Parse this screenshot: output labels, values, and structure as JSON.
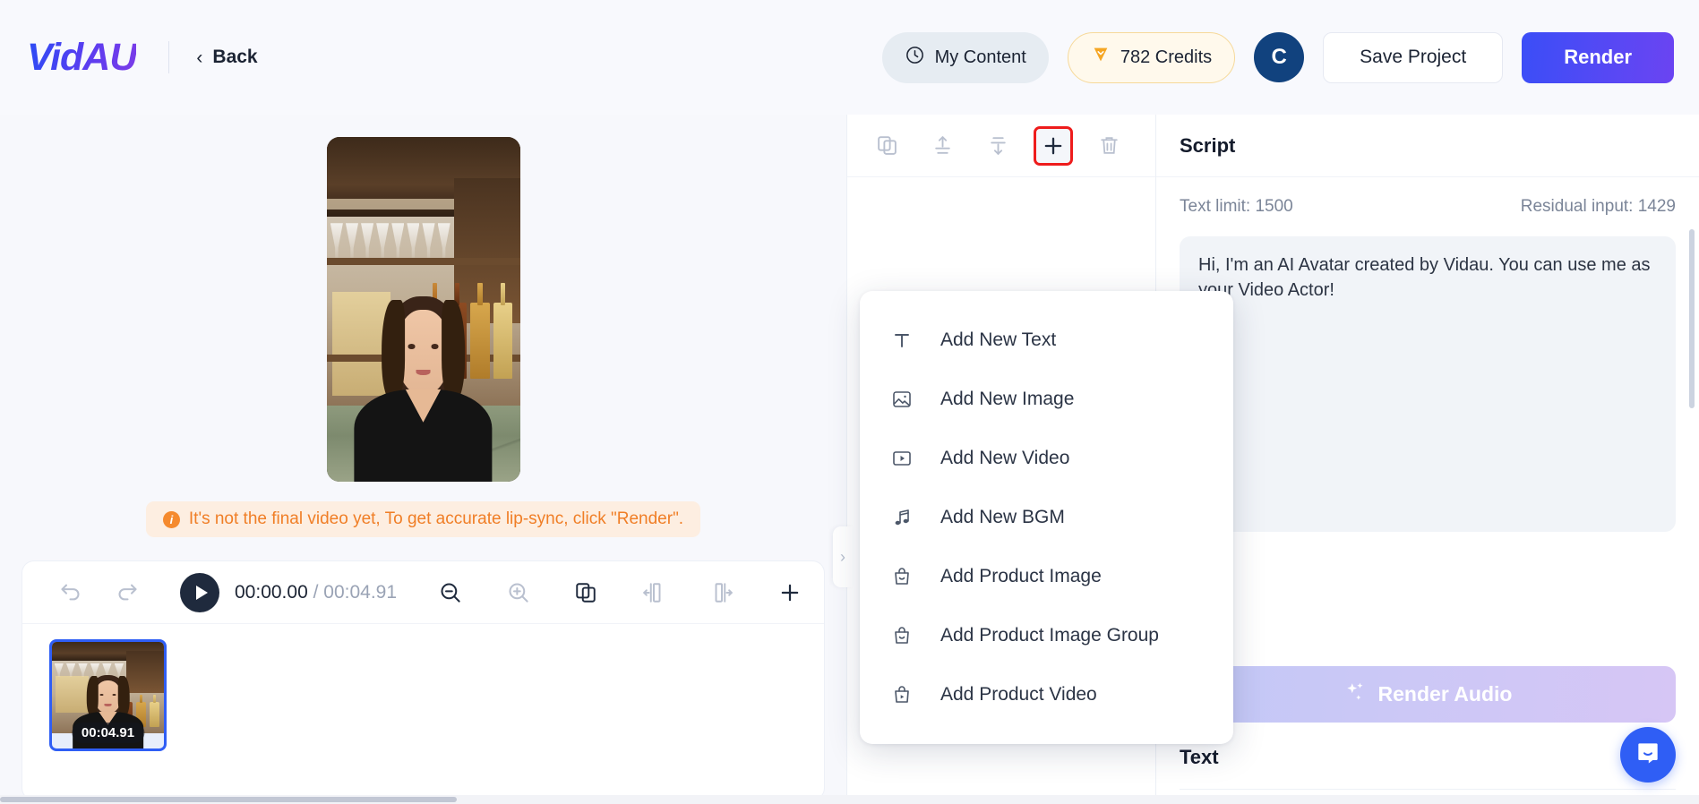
{
  "header": {
    "logo": "VidAU",
    "back_label": "Back",
    "back_icon": "chevron-left-icon",
    "my_content_label": "My Content",
    "my_content_icon": "clock-icon",
    "credits_label": "782 Credits",
    "credits_icon": "diamond-icon",
    "avatar_initial": "C",
    "save_label": "Save Project",
    "render_label": "Render",
    "accent_color": "#3b4ef7",
    "credits_bg": "#fff9ec",
    "avatar_bg": "#11427e"
  },
  "preview": {
    "warning_text": "It's not the final video yet, To get accurate lip-sync, click \"Render\".",
    "warning_icon": "info-icon",
    "warning_color": "#f07e26"
  },
  "timeline": {
    "undo_icon": "undo-icon",
    "redo_icon": "redo-icon",
    "play_icon": "play-icon",
    "current_time": "00:00.00",
    "time_separator": "/",
    "total_time": "00:04.91",
    "zoom_out_icon": "zoom-out-icon",
    "zoom_in_icon": "zoom-in-icon",
    "duplicate_icon": "duplicate-icon",
    "split-left_icon": "split-left-icon",
    "split-right_icon": "split-right-icon",
    "add_icon": "plus-icon",
    "delete_icon": "trash-icon",
    "clip_duration": "00:04.91"
  },
  "edit_toolbar": {
    "copy_icon": "copy-icon",
    "bring_front_icon": "bring-to-front-icon",
    "send_back_icon": "send-to-back-icon",
    "add_icon": "plus-icon",
    "delete_icon": "trash-icon",
    "highlight_color": "#ee1c1c"
  },
  "add_menu": {
    "items": [
      {
        "label": "Add New Text",
        "icon": "text-icon"
      },
      {
        "label": "Add New Image",
        "icon": "image-icon"
      },
      {
        "label": "Add New Video",
        "icon": "video-icon"
      },
      {
        "label": "Add New BGM",
        "icon": "music-note-icon"
      },
      {
        "label": "Add Product Image",
        "icon": "shopping-bag-image-icon"
      },
      {
        "label": "Add Product Image Group",
        "icon": "shopping-bag-group-icon"
      },
      {
        "label": "Add Product Video",
        "icon": "shopping-bag-video-icon"
      }
    ]
  },
  "script_panel": {
    "title": "Script",
    "text_limit": "Text limit: 1500",
    "residual_input": "Residual input: 1429",
    "script_text": "Hi, I'm an AI Avatar created by Vidau. You can use me as your Video Actor!",
    "render_audio_label": "Render Audio",
    "render_audio_icon": "sparkles-icon",
    "text_section_title": "Text"
  },
  "collapse_handle": {
    "icon": "chevron-right-icon"
  },
  "intercom": {
    "icon": "chat-bubble-icon",
    "color": "#2f5ef5"
  }
}
